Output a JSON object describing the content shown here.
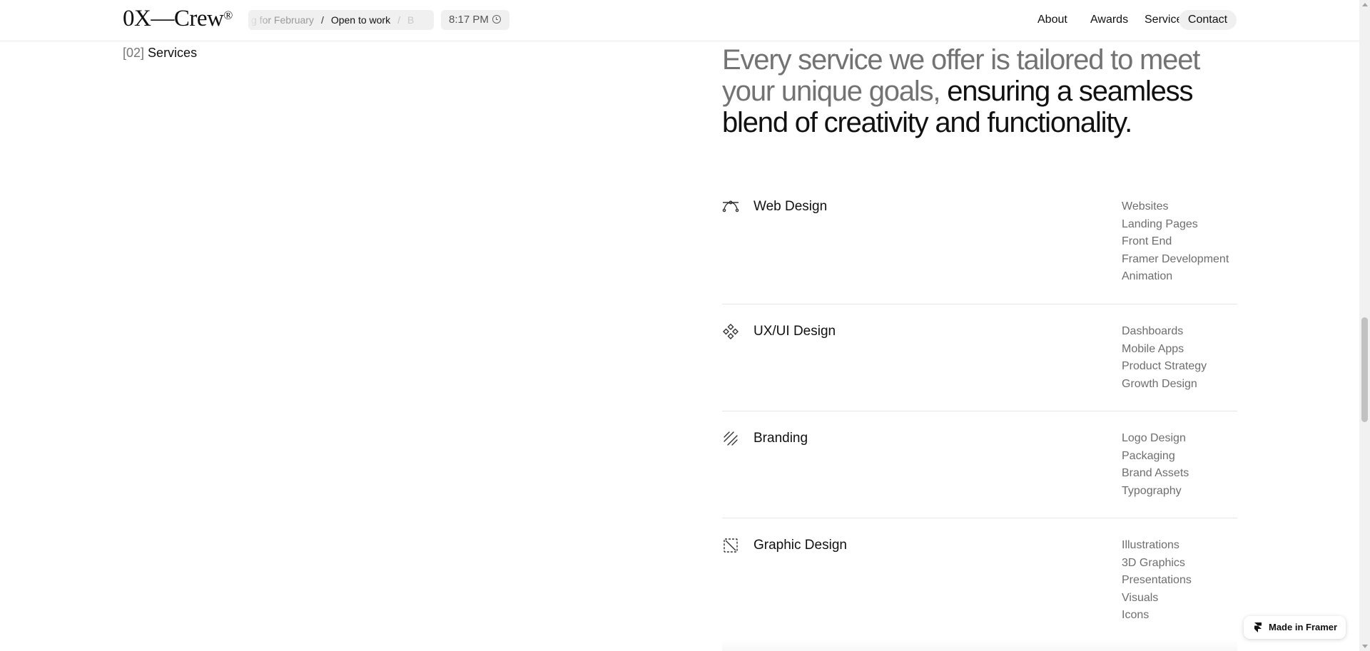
{
  "header": {
    "logo": "0X—Crew",
    "logo_mark": "®",
    "ticker": {
      "prev": "g for February",
      "separator": "/",
      "current": "Open to work",
      "separator2": "/",
      "next": "B"
    },
    "time": "8:17 PM",
    "nav": {
      "about": "About",
      "awards": "Awards",
      "services": "Services",
      "contact": "Contact"
    }
  },
  "section": {
    "number": "[02]",
    "name": "Services"
  },
  "headline": {
    "muted": "Every service we offer is tailored to meet your unique goals,",
    "strong": "ensuring a seamless blend of creativity and functionality."
  },
  "services": [
    {
      "title": "Web Design",
      "icon": "bezier-curve-icon",
      "items": [
        "Websites",
        "Landing Pages",
        "Front End",
        "Framer Development",
        "Animation"
      ]
    },
    {
      "title": "UX/UI Design",
      "icon": "components-icon",
      "items": [
        "Dashboards",
        "Mobile Apps",
        "Product Strategy",
        "Growth Design"
      ]
    },
    {
      "title": "Branding",
      "icon": "signature-icon",
      "items": [
        "Logo Design",
        "Packaging",
        "Brand Assets",
        "Typography"
      ]
    },
    {
      "title": "Graphic Design",
      "icon": "image-off-icon",
      "items": [
        "Illustrations",
        "3D Graphics",
        "Presentations",
        "Visuals",
        "Icons"
      ]
    }
  ],
  "badge": {
    "label": "Made in Framer",
    "icon": "framer-logo-icon"
  },
  "colors": {
    "background": "#ffffff",
    "text": "#111111",
    "muted_text": "#737373",
    "pill_background": "#f0f0f0",
    "divider": "#e6e6e6"
  }
}
